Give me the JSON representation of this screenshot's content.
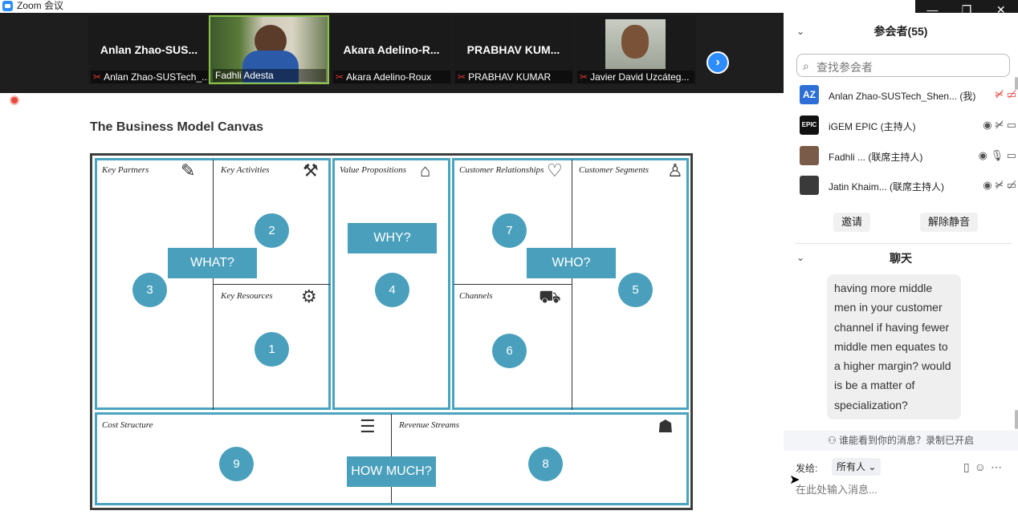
{
  "window": {
    "title": "Zoom 会议",
    "controls": [
      "—",
      "❐",
      "✕"
    ]
  },
  "gallery": {
    "tiles": [
      {
        "name": "Anlan  Zhao-SUS...",
        "label": "Anlan Zhao-SUSTech_...",
        "muted": true,
        "video": false
      },
      {
        "name": "",
        "label": "Fadhli Adesta",
        "muted": false,
        "video": true
      },
      {
        "name": "Akara  Adelino-R...",
        "label": "Akara Adelino-Roux",
        "muted": true,
        "video": false
      },
      {
        "name": "PRABHAV  KUM...",
        "label": "PRABHAV KUMAR",
        "muted": true,
        "video": false
      },
      {
        "name": "",
        "label": "Javier David Uzcáteg...",
        "muted": true,
        "video": true
      }
    ],
    "next_icon": "›"
  },
  "slide": {
    "title": "The Business Model Canvas",
    "labels": {
      "key_partners": "Key Partners",
      "key_activities": "Key Activities",
      "key_resources": "Key Resources",
      "value_propositions": "Value Propositions",
      "customer_relationships": "Customer Relationships",
      "channels": "Channels",
      "customer_segments": "Customer Segments",
      "cost_structure": "Cost Structure",
      "revenue_streams": "Revenue Streams"
    },
    "questions": {
      "what": "WHAT?",
      "why": "WHY?",
      "who": "WHO?",
      "how_much": "HOW MUCH?"
    },
    "numbers": {
      "n1": "1",
      "n2": "2",
      "n3": "3",
      "n4": "4",
      "n5": "5",
      "n6": "6",
      "n7": "7",
      "n8": "8",
      "n9": "9"
    },
    "accent_color": "#4aa0bc"
  },
  "participants": {
    "header": "参会者(55)",
    "search_placeholder": "查找参会者",
    "list": [
      {
        "avatar_text": "AZ",
        "avatar_color": "#2d6fd6",
        "name": "Anlan Zhao-SUSTech_Shen... (我)",
        "icons": "✂̸ ▭̸"
      },
      {
        "avatar_text": "EPIC",
        "avatar_color": "#111111",
        "name": "iGEM EPIC (主持人)",
        "icons": "◉ ✂̸ ▭"
      },
      {
        "avatar_text": "",
        "avatar_color": "#7a5a48",
        "name": "Fadhli ... (联席主持人)",
        "icons": "◉ 🎙 ▭"
      },
      {
        "avatar_text": "",
        "avatar_color": "#3a3a3a",
        "name": "Jatin Khaim... (联席主持人)",
        "icons": "◉ ✂̸ ▭̸"
      }
    ],
    "invite": "邀请",
    "unmute_all": "解除静音"
  },
  "chat": {
    "header": "聊天",
    "message": "having more middle men in your customer channel if having fewer middle men equates to a higher margin? would is be a matter of specialization?",
    "notice": "谁能看到你的消息？录制已开启",
    "send_to_label": "发给:",
    "send_to_value": "所有人",
    "input_placeholder": "在此处输入消息..."
  }
}
